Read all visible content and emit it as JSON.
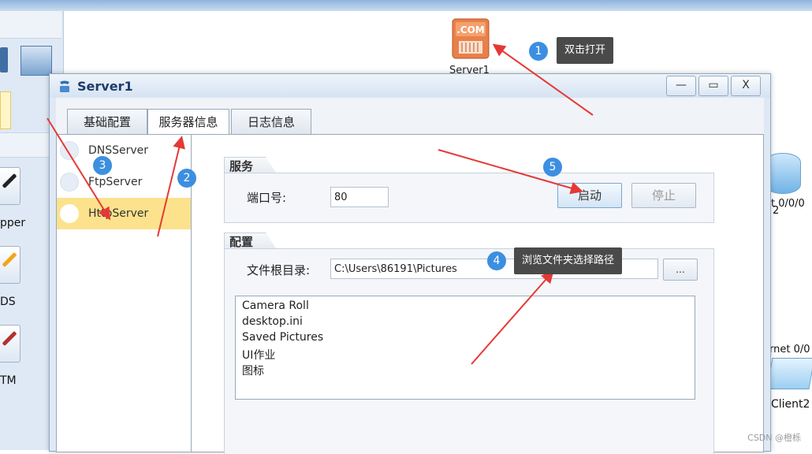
{
  "palette": {
    "accent": "#3c8fe0",
    "selected_row": "#fce28c",
    "arrow": "#e53935",
    "tooltip_bg": "#4a4a4a"
  },
  "left_palette": {
    "tool_labels": [
      "pper",
      "DS",
      "TM"
    ]
  },
  "canvas": {
    "server_label": "Server1",
    "router_label": "et 0/0/0",
    "router_label2": "2",
    "ethernet_label": "ernet 0/0",
    "client_label": "Client2"
  },
  "window": {
    "title": "Server1",
    "controls": {
      "minimize": "—",
      "maximize": "▭",
      "close": "X"
    },
    "tabs": [
      "基础配置",
      "服务器信息",
      "日志信息"
    ],
    "active_tab": "服务器信息",
    "services": [
      "DNSServer",
      "FtpServer",
      "HttpServer"
    ],
    "selected_service": "HttpServer",
    "service_group": {
      "title": "服务",
      "port_label": "端口号:",
      "port_value": "80",
      "start_button": "启动",
      "stop_button": "停止"
    },
    "config_group": {
      "title": "配置",
      "root_label": "文件根目录:",
      "root_value": "C:\\Users\\86191\\Pictures",
      "browse_button": "...",
      "files": [
        "Camera Roll",
        "desktop.ini",
        "Saved Pictures",
        "UI作业",
        "图标"
      ]
    }
  },
  "annotations": [
    {
      "num": "1",
      "text": "双击打开"
    },
    {
      "num": "2",
      "text": ""
    },
    {
      "num": "3",
      "text": ""
    },
    {
      "num": "4",
      "text": "浏览文件夹选择路径"
    },
    {
      "num": "5",
      "text": ""
    }
  ],
  "watermark": "CSDN @橙栎"
}
